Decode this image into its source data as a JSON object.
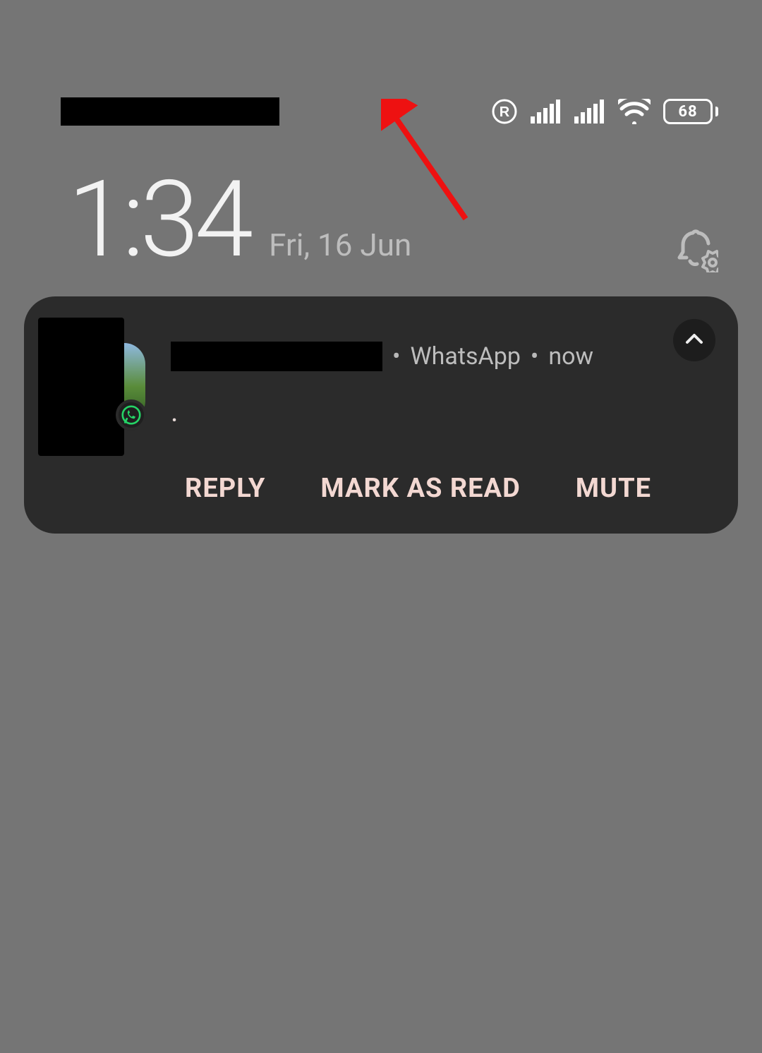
{
  "status": {
    "battery_percent": "68"
  },
  "clock": {
    "time": "1:34",
    "date": "Fri, 16 Jun"
  },
  "notification": {
    "app": "WhatsApp",
    "when": "now",
    "body": ".",
    "actions": {
      "reply": "REPLY",
      "mark_read": "MARK AS READ",
      "mute": "MUTE"
    }
  }
}
